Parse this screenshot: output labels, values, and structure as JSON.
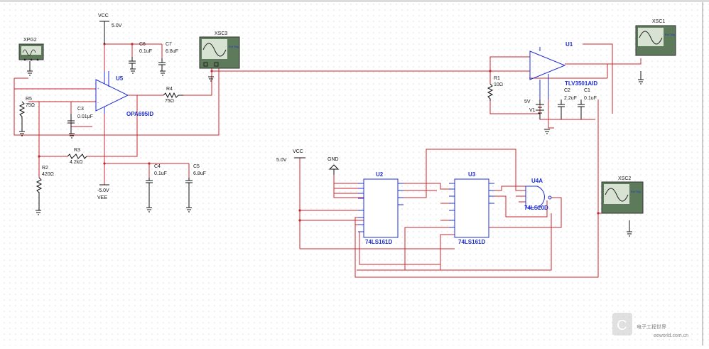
{
  "supply": {
    "vcc": "VCC",
    "vcc_v": "5.0V",
    "vee": "VEE",
    "vee_v": "-5.0V",
    "vcc2": "VCC",
    "vcc2_v": "5.0V",
    "gnd": "GND"
  },
  "components": {
    "xpg2": "XPG2",
    "xsc3": "XSC3",
    "xsc1": "XSC1",
    "xsc2": "XSC2",
    "u5": "U5",
    "u5_part": "OPA695ID",
    "u1": "U1",
    "u1_part": "TLV3501AID",
    "u2": "U2",
    "u2_part": "74LS161D",
    "u3": "U3",
    "u3_part": "74LS161D",
    "u4a": "U4A",
    "u4a_part": "74LS20D",
    "r5": "R5",
    "r5_v": "75Ω",
    "r4": "R4",
    "r4_v": "75Ω",
    "r3": "R3",
    "r3_v": "4.2kΩ",
    "r2": "R2",
    "r2_v": "420Ω",
    "r1": "R1",
    "r1_v": "10Ω",
    "c6": "C6",
    "c6_v": "0.1uF",
    "c7": "C7",
    "c7_v": "6.8uF",
    "c3": "C3",
    "c3_v": "0.01μF",
    "c4": "C4",
    "c4_v": "0.1uF",
    "c5": "C5",
    "c5_v": "6.8uF",
    "c2": "C2",
    "c2_v": "2.2uF",
    "c1": "C1",
    "c1_v": "0.1uF",
    "v1": "V1",
    "v1_v": "5V"
  },
  "scope_labels": {
    "ext_trig": "Ext Trig"
  },
  "watermark": {
    "text": "电子工程世界",
    "sub": "eeworld.com.cn"
  },
  "colors": {
    "wire": "#c8262c",
    "part": "#1f2fd6",
    "scope_body": "#5d7a5a",
    "scope_face": "#d8e2d2"
  }
}
